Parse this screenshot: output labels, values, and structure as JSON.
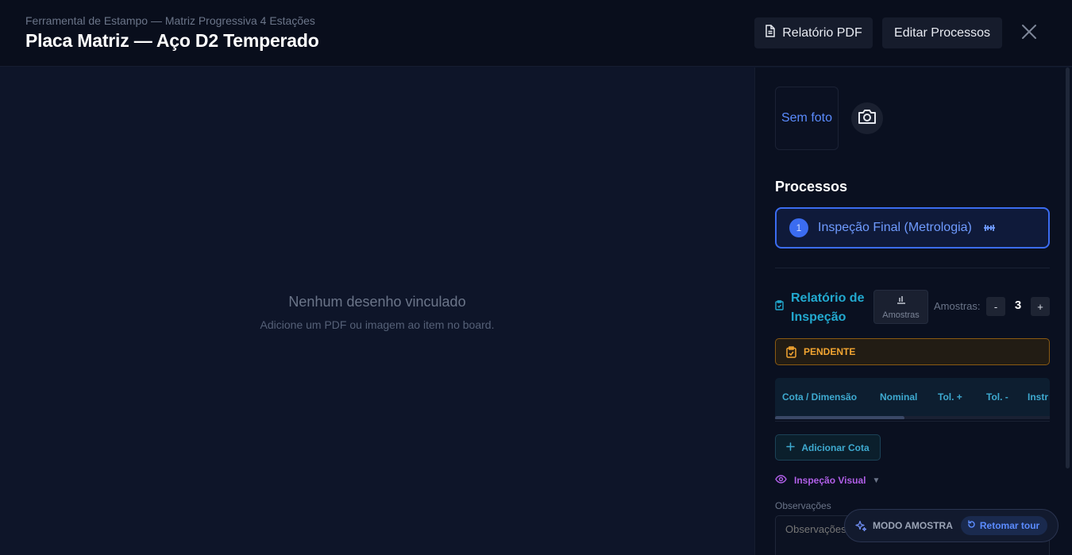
{
  "header": {
    "subtitle": "Ferramental de Estampo — Matriz Progressiva 4 Estações",
    "title": "Placa Matriz — Aço D2 Temperado",
    "pdf_button": "Relatório PDF",
    "edit_button": "Editar Processos"
  },
  "viewer": {
    "empty_title": "Nenhum desenho vinculado",
    "empty_subtitle": "Adicione um PDF ou imagem ao item no board."
  },
  "panel": {
    "photo_placeholder": "Sem foto",
    "processes_title": "Processos",
    "process": {
      "number": "1",
      "label": "Inspeção Final (Metrologia)"
    },
    "report": {
      "title": "Relatório de Inspeção",
      "samples_button": "Amostras",
      "samples_label": "Amostras:",
      "minus": "-",
      "plus": "+",
      "samples_count": "3",
      "status": "PENDENTE",
      "columns": [
        "Cota / Dimensão",
        "Nominal",
        "Tol. +",
        "Tol. -",
        "Instr"
      ],
      "add_cota": "Adicionar Cota",
      "visual_inspection": "Inspeção Visual",
      "obs_label": "Observações",
      "obs_placeholder": "Observações"
    }
  },
  "demo": {
    "mode_label": "MODO AMOSTRA",
    "tour_button": "Retomar tour"
  },
  "colors": {
    "accent_blue": "#3b6cf0",
    "cyan": "#22a9cf",
    "pending_orange": "#f3a531",
    "purple": "#b15fe8"
  }
}
